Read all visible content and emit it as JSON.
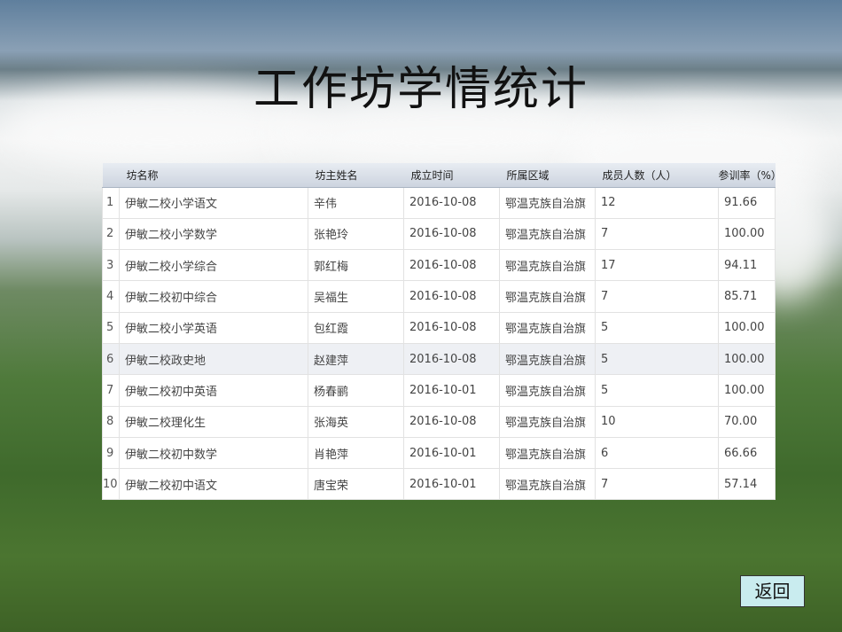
{
  "title": "工作坊学情统计",
  "columns": [
    "",
    "坊名称",
    "坊主姓名",
    "成立时间",
    "所属区域",
    "成员人数（人）",
    "参训率（%）"
  ],
  "rows": [
    [
      "1",
      "伊敏二校小学语文",
      "辛伟",
      "2016-10-08",
      "鄂温克族自治旗",
      "12",
      "91.66"
    ],
    [
      "2",
      "伊敏二校小学数学",
      "张艳玲",
      "2016-10-08",
      "鄂温克族自治旗",
      "7",
      "100.00"
    ],
    [
      "3",
      "伊敏二校小学综合",
      "郭红梅",
      "2016-10-08",
      "鄂温克族自治旗",
      "17",
      "94.11"
    ],
    [
      "4",
      "伊敏二校初中综合",
      "吴福生",
      "2016-10-08",
      "鄂温克族自治旗",
      "7",
      "85.71"
    ],
    [
      "5",
      "伊敏二校小学英语",
      "包红霞",
      "2016-10-08",
      "鄂温克族自治旗",
      "5",
      "100.00"
    ],
    [
      "6",
      "伊敏二校政史地",
      "赵建萍",
      "2016-10-08",
      "鄂温克族自治旗",
      "5",
      "100.00"
    ],
    [
      "7",
      "伊敏二校初中英语",
      "杨春鹂",
      "2016-10-01",
      "鄂温克族自治旗",
      "5",
      "100.00"
    ],
    [
      "8",
      "伊敏二校理化生",
      "张海英",
      "2016-10-08",
      "鄂温克族自治旗",
      "10",
      "70.00"
    ],
    [
      "9",
      "伊敏二校初中数学",
      "肖艳萍",
      "2016-10-01",
      "鄂温克族自治旗",
      "6",
      "66.66"
    ],
    [
      "10",
      "伊敏二校初中语文",
      "唐宝荣",
      "2016-10-01",
      "鄂温克族自治旗",
      "7",
      "57.14"
    ]
  ],
  "highlighted_row": 6,
  "back_label": "返回"
}
